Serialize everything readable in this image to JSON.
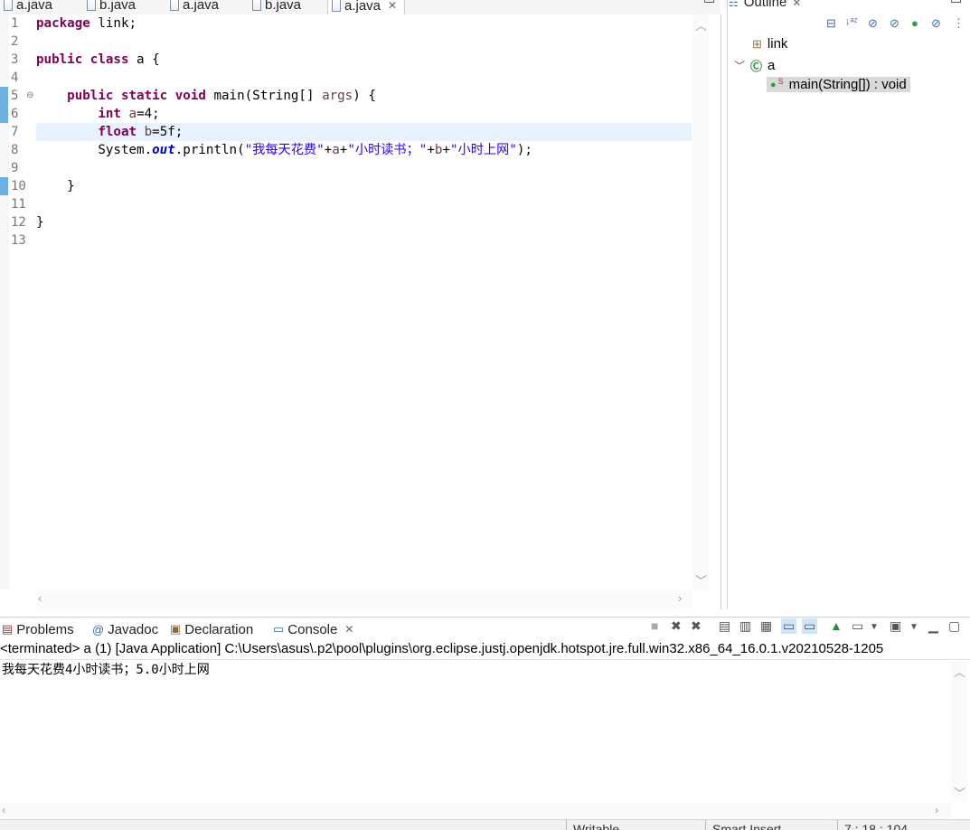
{
  "editor_tabs": [
    {
      "label": "a.java"
    },
    {
      "label": "b.java"
    },
    {
      "label": "a.java"
    },
    {
      "label": "b.java"
    },
    {
      "label": "a.java",
      "active": true
    }
  ],
  "editor": {
    "line_numbers": [
      "1",
      "2",
      "3",
      "4",
      "5",
      "6",
      "7",
      "8",
      "9",
      "10",
      "11",
      "12",
      "13"
    ],
    "lines": [
      {
        "kw": "package",
        "rest": " link;"
      },
      {},
      {
        "kw1": "public",
        "kw2": "class",
        "rest": " a {"
      },
      {},
      {
        "kw1": "public",
        "kw2": "static",
        "kw3": "void",
        "rest": " main(String[] ",
        "param": "args",
        "tail": ") {"
      },
      {
        "kw": "int",
        "var": " a",
        "rest": "=4;"
      },
      {
        "kw": "float",
        "var": " b",
        "rest": "=5f;"
      },
      {
        "pre": "System.",
        "field": "out",
        "mid": ".println(",
        "s1": "\"我每天花费\"",
        "op1": "+",
        "v1": "a",
        "op2": "+",
        "s2": "\"小时读书；\"",
        "op3": "+",
        "v2": "b",
        "op4": "+",
        "s3": "\"小时上网\"",
        "end": ");"
      },
      {},
      {
        "rest": "    }"
      },
      {},
      {
        "rest": "}"
      },
      {}
    ],
    "current_line": 7
  },
  "outline": {
    "tab_label": "Outline",
    "items": [
      {
        "label": "link",
        "icon": "package-icon"
      },
      {
        "label": "a",
        "icon": "class-icon"
      },
      {
        "label": "main(String[]) : void",
        "icon": "method-icon",
        "selected": true
      }
    ]
  },
  "console": {
    "tabs": [
      {
        "label": "Problems"
      },
      {
        "label": "Javadoc"
      },
      {
        "label": "Declaration"
      },
      {
        "label": "Console",
        "active": true
      }
    ],
    "header": "<terminated> a (1) [Java Application] C:\\Users\\asus\\.p2\\pool\\plugins\\org.eclipse.justj.openjdk.hotspot.jre.full.win32.x86_64_16.0.1.v20210528-1205",
    "output": "我每天花费4小时读书；5.0小时上网"
  },
  "statusbar": {
    "mode": "Writable",
    "insert": "Smart Insert",
    "position": "7 : 18 : 104"
  },
  "colors": {
    "keyword": "#7f0055",
    "string": "#2a00ff",
    "variable": "#6a3e3e",
    "field": "#0000c0",
    "current_line": "#e8f2fe",
    "change_marker": "#6bb0e0"
  }
}
